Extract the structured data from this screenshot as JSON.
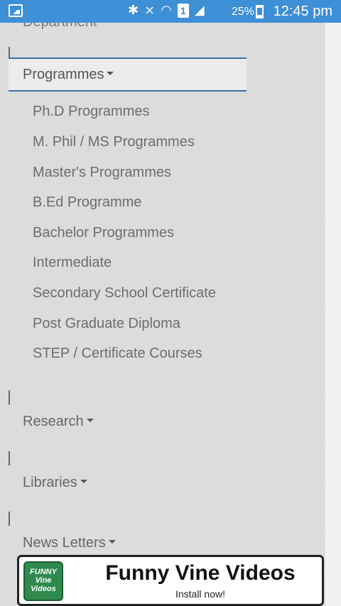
{
  "status_bar": {
    "battery_percent": "25%",
    "time": "12:45 pm",
    "sim_label": "1",
    "icons": [
      "gallery-icon",
      "bluetooth-icon",
      "mute-icon",
      "wifi-icon",
      "sim-icon",
      "signal-icon",
      "battery-icon"
    ]
  },
  "menu": {
    "partial_top_label": "Department",
    "programmes": {
      "label": "Programmes",
      "items": [
        "Ph.D Programmes",
        "M. Phil / MS Programmes",
        "Master's Programmes",
        "B.Ed Programme",
        "Bachelor Programmes",
        "Intermediate",
        "Secondary School Certificate",
        "Post Graduate Diploma",
        "STEP / Certificate Courses"
      ]
    },
    "research_label": "Research",
    "libraries_label": "Libraries",
    "newsletters_label": "News Letters"
  },
  "ad": {
    "logo_line1": "FUNNY",
    "logo_line2": "Vine",
    "logo_line3": "Videos",
    "title": "Funny Vine Videos",
    "subtitle": "Install now!",
    "accent_color": "#2f8a4e"
  },
  "colors": {
    "status_bar": "#3d8fd6",
    "background": "#dcdcdc",
    "active_border": "#3d6fa8"
  }
}
